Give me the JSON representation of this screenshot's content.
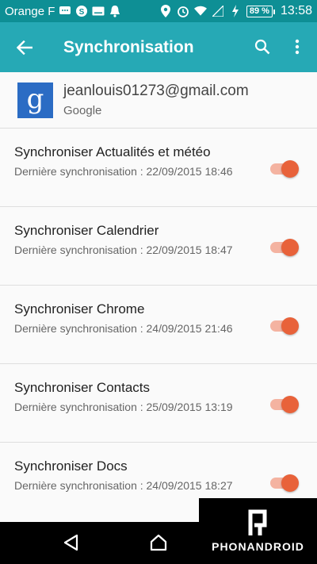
{
  "status_bar": {
    "carrier": "Orange F",
    "battery": "89 %",
    "time": "13:58"
  },
  "app_bar": {
    "title": "Synchronisation"
  },
  "account": {
    "email": "jeanlouis01273@gmail.com",
    "type": "Google",
    "logo_letter": "g"
  },
  "sync_items": [
    {
      "title": "Synchroniser Actualités et météo",
      "subtitle": "Dernière synchronisation : 22/09/2015 18:46",
      "enabled": true
    },
    {
      "title": "Synchroniser Calendrier",
      "subtitle": "Dernière synchronisation : 22/09/2015 18:47",
      "enabled": true
    },
    {
      "title": "Synchroniser Chrome",
      "subtitle": "Dernière synchronisation : 24/09/2015 21:46",
      "enabled": true
    },
    {
      "title": "Synchroniser Contacts",
      "subtitle": "Dernière synchronisation : 25/09/2015 13:19",
      "enabled": true
    },
    {
      "title": "Synchroniser Docs",
      "subtitle": "Dernière synchronisation : 24/09/2015 18:27",
      "enabled": true
    }
  ],
  "watermark": {
    "text": "PHONANDROID"
  },
  "colors": {
    "status_bar": "#0e8f95",
    "app_bar": "#26a9b5",
    "toggle_thumb": "#e8623a",
    "toggle_track": "#f4b3a1"
  }
}
